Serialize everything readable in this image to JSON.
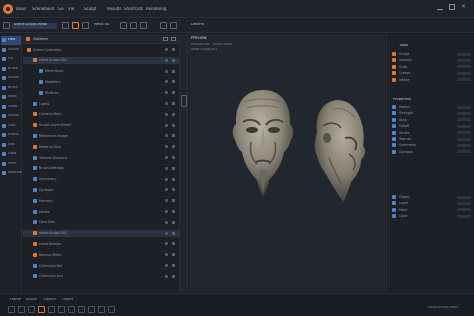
{
  "app": {
    "menu": [
      "Deus",
      "Scenebuild",
      "Ge",
      "Vie",
      "Sculpt",
      "Results",
      "Shortcuts",
      "Rendering"
    ],
    "accent": "#e8772e",
    "selection": "#2e4a72",
    "search_value": "Scene.Sculpt.Head"
  },
  "toolbar2": {
    "file_label": "Mesh.3D",
    "mode_label": "Deform"
  },
  "rail": {
    "items": [
      "Fold",
      "Sculpt",
      "Pix",
      "Brush",
      "Sculpt",
      "Brush",
      "Mask",
      "Draw",
      "Sculpt",
      "Clay",
      "Scene",
      "Edit",
      "Data",
      "Paint",
      "Material"
    ]
  },
  "outliner": {
    "title": "Outliner",
    "rows": [
      {
        "label": "Scene Collection",
        "color": "#e0782f"
      },
      {
        "label": "  Head.Sculpt.001",
        "color": "#e0782f"
      },
      {
        "label": "    Mesh.Body",
        "color": "#4f86c6"
      },
      {
        "label": "    Modifiers",
        "color": "#4f86c6"
      },
      {
        "label": "    Multires",
        "color": "#4f86c6"
      },
      {
        "label": "  Lights",
        "color": "#4f86c6"
      },
      {
        "label": "  Camera.Main",
        "color": "#e0782f"
      },
      {
        "label": "  Sculpt.Layer.Detail",
        "color": "#e0782f"
      },
      {
        "label": "  Reference.Image",
        "color": "#4f86c6"
      },
      {
        "label": "  Material.Skin",
        "color": "#e0782f"
      },
      {
        "label": "  Texture.Displace",
        "color": "#4f86c6"
      },
      {
        "label": "  Brush.Settings",
        "color": "#4f86c6"
      },
      {
        "label": "  Symmetry",
        "color": "#4f86c6"
      },
      {
        "label": "  Dyntopo",
        "color": "#4f86c6"
      },
      {
        "label": "  Remesh",
        "color": "#4f86c6"
      },
      {
        "label": "  Masks",
        "color": "#4f86c6"
      },
      {
        "label": "  Face.Sets",
        "color": "#4f86c6"
      },
      {
        "label": "  Head.Sculpt.002",
        "color": "#e0782f"
      },
      {
        "label": "  Head.Retopo",
        "color": "#e0782f"
      },
      {
        "label": "  Backup.Mesh",
        "color": "#e0782f"
      },
      {
        "label": "  Collection.Ref",
        "color": "#4f86c6"
      },
      {
        "label": "  Collection.Env",
        "color": "#4f86c6"
      }
    ]
  },
  "viewport": {
    "title": "Preview",
    "info_line_1": "Perspective · Sculpt Mode",
    "info_line_2": "Head.Sculpt.001"
  },
  "props": {
    "section_1": "Tools",
    "rows_1": [
      "Sculpt",
      "Smooth",
      "Grab",
      "Crease",
      "Inflate"
    ],
    "section_2": "Properties",
    "rows_2": [
      "Radius",
      "Strength",
      "Auto",
      "Falloff",
      "Stroke",
      "Texture",
      "Symmetry",
      "Dyntopo"
    ],
    "rows_3": [
      "Object",
      "Layer",
      "Mask",
      "Color"
    ]
  },
  "statusbar": {
    "tabs": [
      "Frame",
      "Sculpt",
      "Layout",
      "Object"
    ],
    "right_text": "Head.Sculpt.Mesh"
  }
}
